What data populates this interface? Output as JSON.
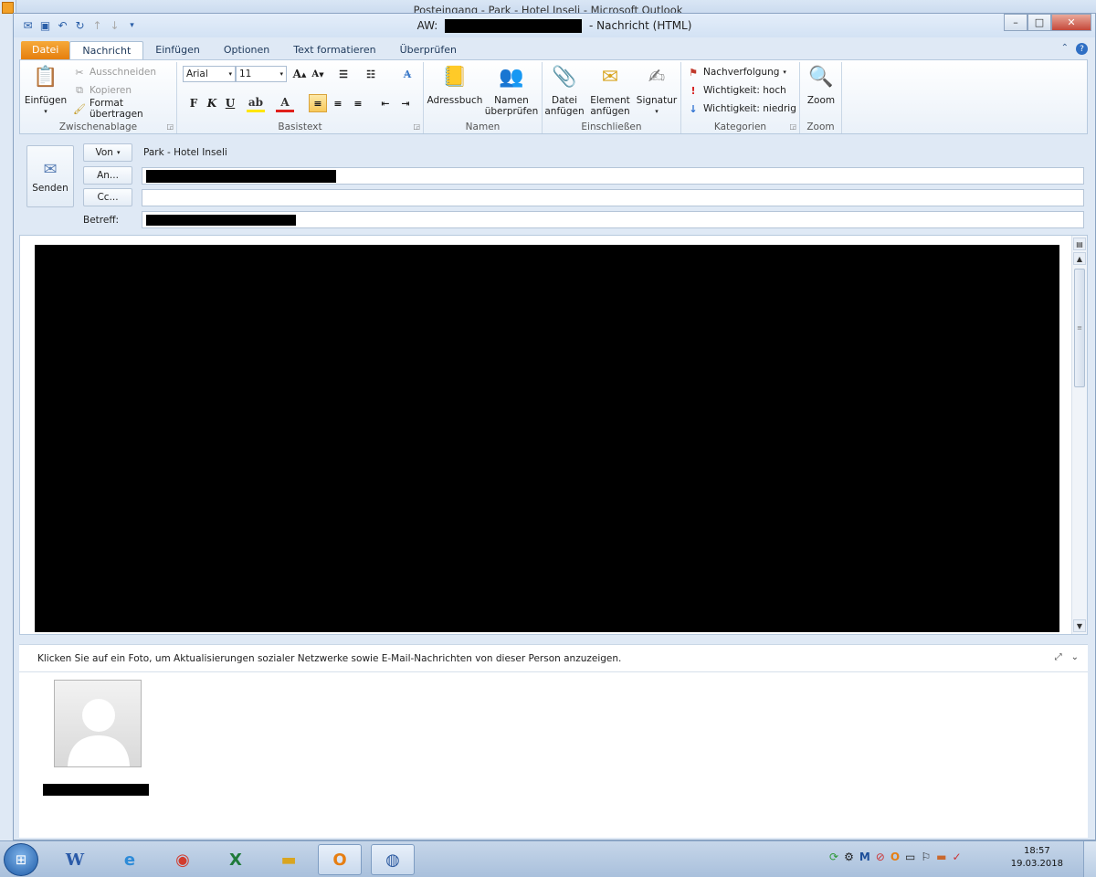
{
  "background_window": {
    "title": "Posteingang - Park - Hotel Inseli - Microsoft Outlook"
  },
  "window": {
    "title_prefix": "AW:",
    "title_suffix": "- Nachricht (HTML)"
  },
  "tabs": [
    "Datei",
    "Nachricht",
    "Einfügen",
    "Optionen",
    "Text formatieren",
    "Überprüfen"
  ],
  "ribbon": {
    "clipboard": {
      "label": "Zwischenablage",
      "paste": "Einfügen",
      "cut": "Ausschneiden",
      "copy": "Kopieren",
      "format_painter": "Format übertragen"
    },
    "basic_text": {
      "label": "Basistext",
      "font": "Arial",
      "size": "11",
      "bold": "F",
      "italic": "K",
      "underline": "U"
    },
    "names": {
      "label": "Namen",
      "address_book": "Adressbuch",
      "check_names_1": "Namen",
      "check_names_2": "überprüfen"
    },
    "include": {
      "label": "Einschließen",
      "attach_file_1": "Datei",
      "attach_file_2": "anfügen",
      "attach_item_1": "Element",
      "attach_item_2": "anfügen",
      "signature": "Signatur"
    },
    "tags": {
      "label": "Kategorien",
      "follow_up": "Nachverfolgung",
      "high": "Wichtigkeit: hoch",
      "low": "Wichtigkeit: niedrig"
    },
    "zoom": {
      "label": "Zoom",
      "zoom": "Zoom"
    }
  },
  "form": {
    "send": "Senden",
    "from_button": "Von",
    "from_value": "Park - Hotel Inseli",
    "to_button": "An...",
    "cc_button": "Cc...",
    "subject_label": "Betreff:"
  },
  "people_pane": {
    "hint": "Klicken Sie auf ein Foto, um Aktualisierungen sozialer Netzwerke sowie E-Mail-Nachrichten von dieser Person anzuzeigen."
  },
  "taskbar": {
    "time": "18:57",
    "date": "19.03.2018"
  },
  "colors": {
    "file_tab": "#e57f0d",
    "ribbon_bg": "#eaf1f9",
    "accent": "#2b5fa8"
  }
}
